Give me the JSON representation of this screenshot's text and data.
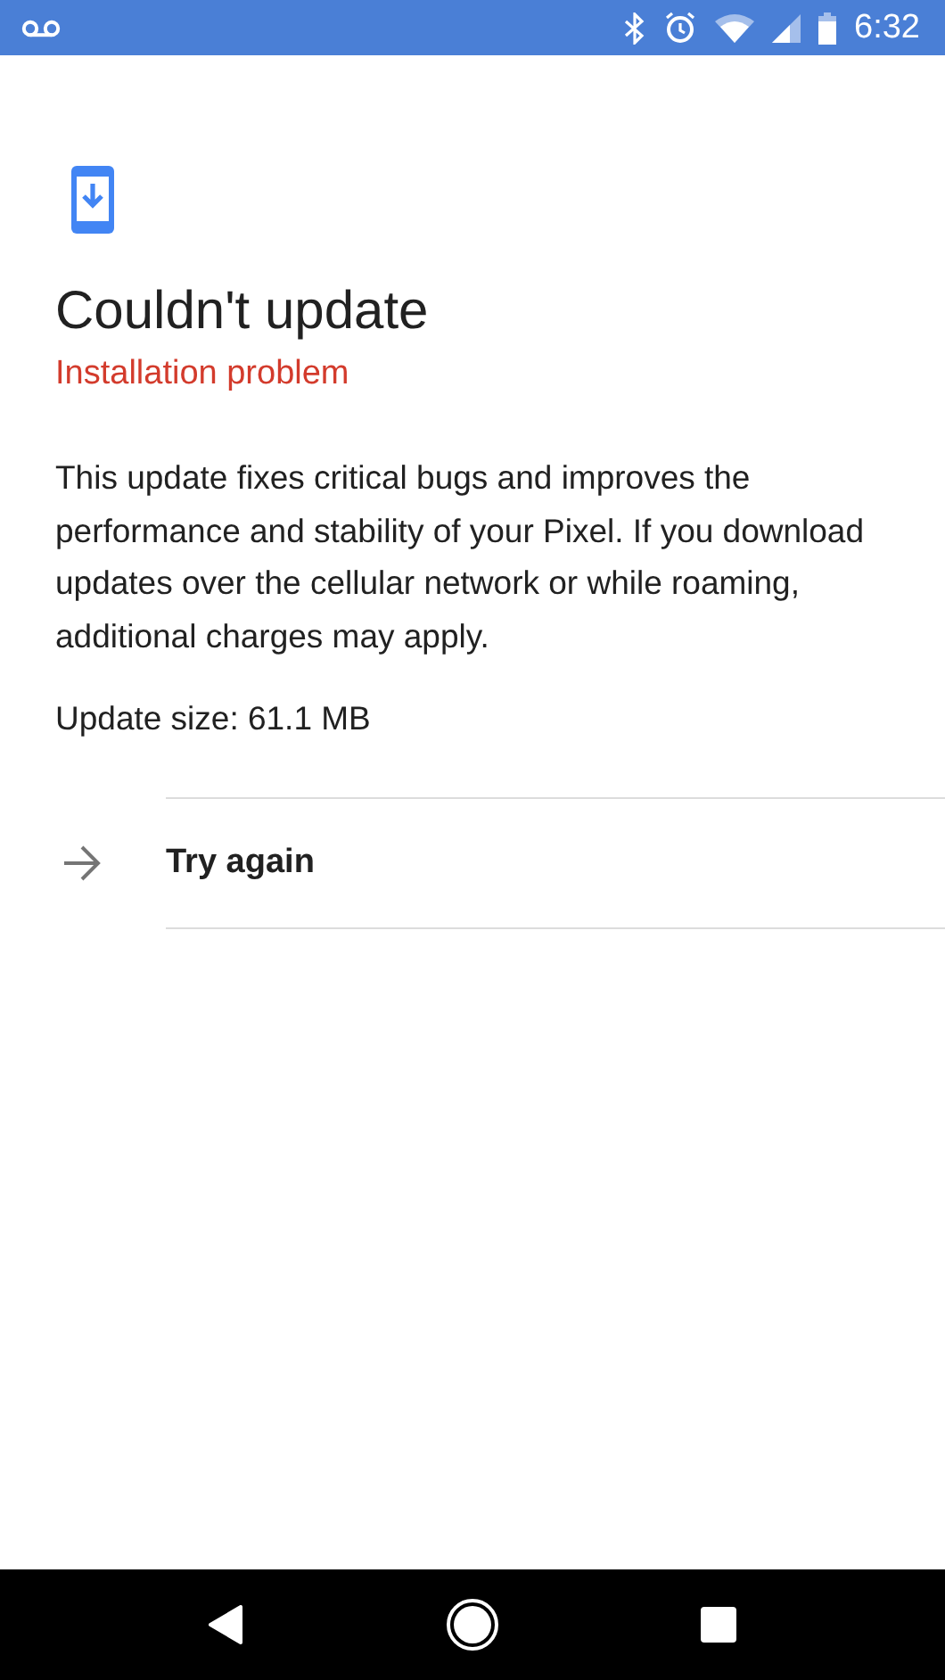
{
  "status_bar": {
    "time": "6:32"
  },
  "title": "Couldn't update",
  "subtitle": "Installation problem",
  "description": "This update fixes critical bugs and improves the performance and stability of your Pixel. If you download updates over the cellular network or while roaming, additional charges may apply.",
  "update_size": "Update size: 61.1 MB",
  "actions": [
    {
      "label": "Try again"
    }
  ]
}
